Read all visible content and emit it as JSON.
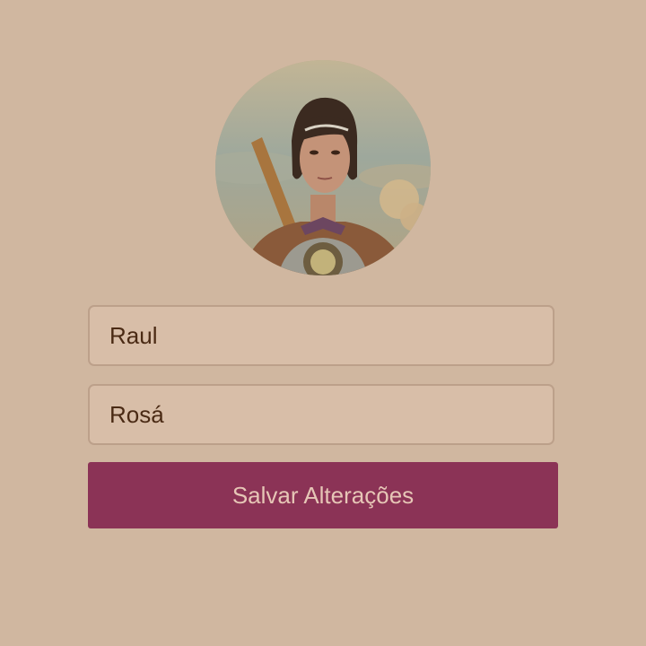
{
  "profile": {
    "avatar_icon": "character-portrait-avatar",
    "first_name": "Raul",
    "last_name": "Rosá"
  },
  "actions": {
    "save_label": "Salvar Alterações"
  },
  "colors": {
    "background": "#d0b7a0",
    "field_background": "#d8bea8",
    "field_border": "#bca08a",
    "field_text": "#4a2a14",
    "button_background": "#8b3356",
    "button_text": "#e6c6b6"
  }
}
